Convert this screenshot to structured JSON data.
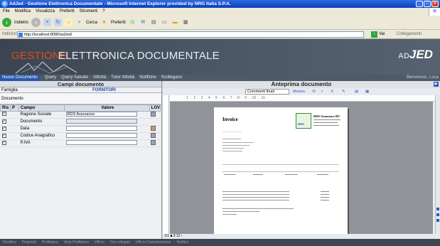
{
  "window": {
    "title": "AdJed - Gestione Elettronica Documentale - Microsoft Internet Explorer provided by NRG Italia S.P.A."
  },
  "menu": [
    "File",
    "Modifica",
    "Visualizza",
    "Preferiti",
    "Strumenti",
    "?"
  ],
  "toolbar": {
    "back": "Indietro",
    "search": "Cerca",
    "favorites": "Preferiti"
  },
  "address": {
    "label": "Indirizzo",
    "url": "http://localhost:8080/adJed/",
    "go": "Vai",
    "links": "Collegamenti"
  },
  "banner": {
    "title_part1": "GESTIONE",
    "title_part2": "ELETTRONICA DOCUMENTALE",
    "logo_prefix": "AD",
    "logo_main": "JED"
  },
  "nav": {
    "items": [
      "Nuovo Documento",
      "Query",
      "Query Salvate",
      "Attività",
      "Tutor Attività",
      "Notifiche",
      "Scollegarsi"
    ],
    "user": "Benvenuto, Luca"
  },
  "left": {
    "title": "Campi documento",
    "famiglia_label": "Famiglia",
    "famiglia_value": "FORNITORI",
    "documento_label": "Documento",
    "columns": [
      "Ris",
      "P",
      "Campo",
      "Valore",
      "LOV"
    ],
    "rows": [
      {
        "campo": "Ragione Sociale",
        "valore": "RDS Assurance"
      },
      {
        "campo": "Documento",
        "valore": ""
      },
      {
        "campo": "Data",
        "valore": ""
      },
      {
        "campo": "Codice Anagrafico",
        "valore": ""
      },
      {
        "campo": "P.IVA",
        "valore": ""
      }
    ]
  },
  "right": {
    "title": "Anteprima documento",
    "markup_select": "Commenti finali",
    "show_menu": "Mostra",
    "ruler": "· 1 · · 2 · · 3 · · 4 · · 5 · · 6 · · 7 · · 8 · · 9 · · 10 · · 11 ·",
    "status": "1/1 ■ 3 12 ‹",
    "page": {
      "heading": "Invoice",
      "logo_text": "RDS",
      "company": "RDS Assurance BV"
    }
  },
  "footer": [
    "Modifica",
    "Proprietà",
    "Profilatura",
    "Visto Profilatura",
    "Ufficio",
    "Ora collegati",
    "Ufficio Comunicazione",
    "Notifica"
  ]
}
